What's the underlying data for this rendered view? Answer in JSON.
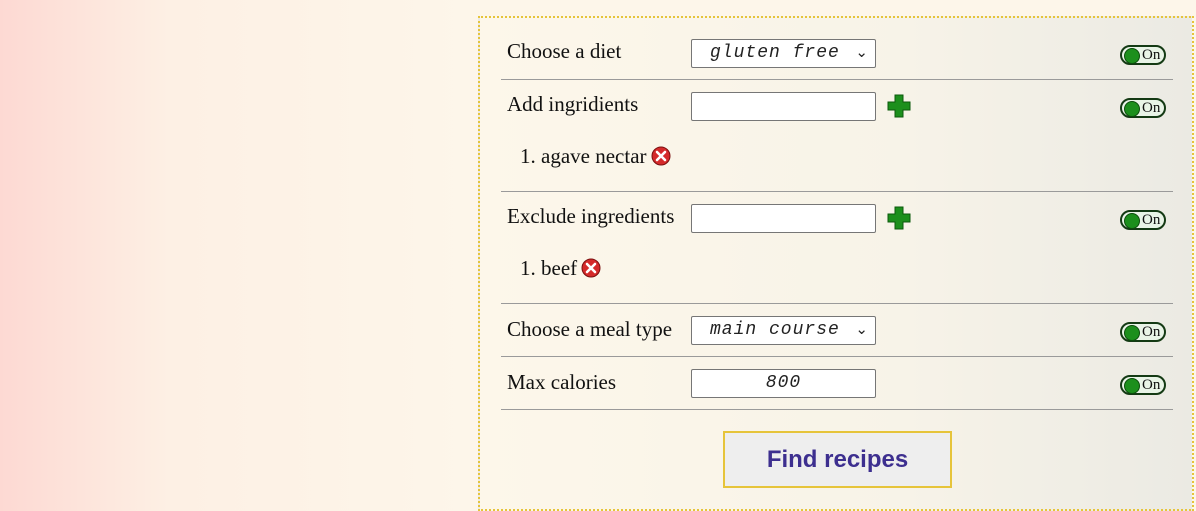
{
  "form": {
    "diet": {
      "label": "Choose a diet",
      "selected": "gluten free",
      "toggle": "On"
    },
    "add_ingredients": {
      "label": "Add ingridients",
      "value": "",
      "toggle": "On",
      "items": [
        "1. agave nectar"
      ]
    },
    "exclude_ingredients": {
      "label": "Exclude ingredients",
      "value": "",
      "toggle": "On",
      "items": [
        "1. beef"
      ]
    },
    "meal_type": {
      "label": "Choose a meal type",
      "selected": "main course",
      "toggle": "On"
    },
    "max_calories": {
      "label": "Max calories",
      "value": "800",
      "toggle": "On"
    },
    "submit_label": "Find recipes"
  },
  "icons": {
    "dropdown": "chevron-down-icon",
    "add": "plus-icon",
    "remove": "close-circle-icon",
    "toggle": "toggle-switch"
  },
  "colors": {
    "accent_border": "#e6c43a",
    "button_text": "#3d2f8f",
    "plus_green": "#1c8f1c",
    "remove_red": "#d42a2a",
    "toggle_knob": "#1c8f1c"
  }
}
